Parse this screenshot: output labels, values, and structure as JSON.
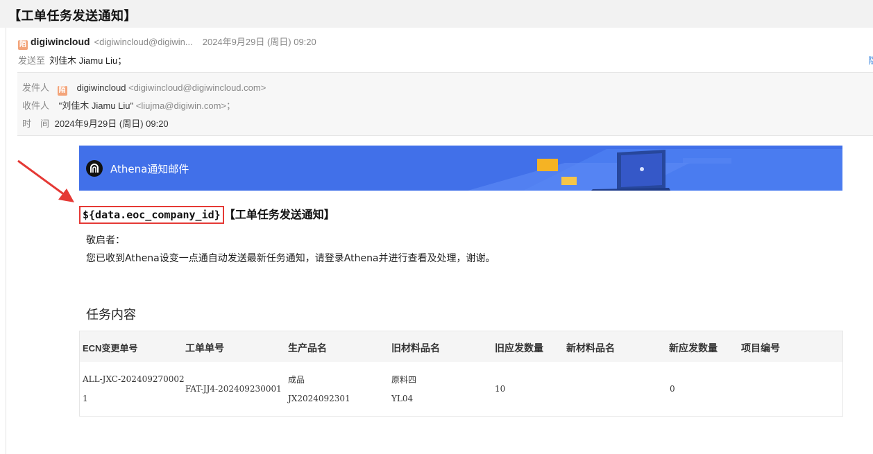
{
  "window": {
    "title": "【工单任务发送通知】"
  },
  "summary": {
    "sender_badge": "陌",
    "sender_name": "digiwincloud",
    "sender_email": "<digiwincloud@digiwin...",
    "date": "2024年9月29日 (周日) 09:20",
    "to_label": "发送至",
    "to_value": "刘佳木 Jiamu Liu；",
    "side_link": "隐"
  },
  "details": {
    "from_label": "发件人",
    "from_badge": "陌",
    "from_name": "digiwincloud",
    "from_email": "<digiwincloud@digiwincloud.com>",
    "to_label": "收件人",
    "to_value": "\"刘佳木 Jiamu Liu\"",
    "to_email": "<liujma@digiwin.com>；",
    "time_label": "时　间",
    "time_value": "2024年9月29日 (周日) 09:20"
  },
  "email": {
    "banner_title": "Athena通知邮件",
    "headline_placeholder": "${data.eoc_company_id}",
    "headline_text": "【工单任务发送通知】",
    "greeting": "敬启者：",
    "paragraph": "您已收到Athena设变一点通自动发送最新任务通知，请登录Athena并进行查看及处理，谢谢。",
    "section_title": "任务内容",
    "table": {
      "headers": [
        "ECN变更单号",
        "工单单号",
        "生产品名",
        "旧材料品名",
        "旧应发数量",
        "新材料品名",
        "新应发数量",
        "项目编号"
      ],
      "row": {
        "ecn_line1": "ALL-JXC-202409270002",
        "ecn_line2": "1",
        "work_order": "FAT-JJ4-202409230001",
        "product_name": "成品",
        "product_code": "JX2024092301",
        "old_material_name": "原料四",
        "old_material_code": "YL04",
        "old_qty": "10",
        "new_material_name": "",
        "new_qty": "0",
        "project_no": ""
      }
    }
  },
  "colors": {
    "banner": "#4170e9",
    "highlight_box": "#e53935",
    "annotation_arrow": "#e53935",
    "link": "#4a8fe0"
  }
}
